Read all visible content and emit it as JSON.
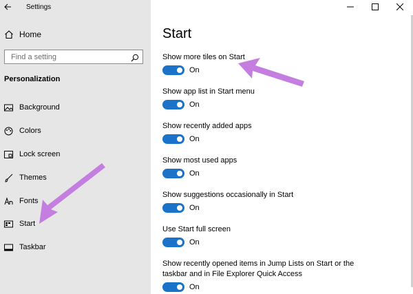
{
  "window": {
    "title": "Settings"
  },
  "sidebar": {
    "home_label": "Home",
    "search_placeholder": "Find a setting",
    "section_title": "Personalization",
    "items": [
      {
        "label": "Background",
        "icon": "picture-icon"
      },
      {
        "label": "Colors",
        "icon": "palette-icon"
      },
      {
        "label": "Lock screen",
        "icon": "lock-screen-icon"
      },
      {
        "label": "Themes",
        "icon": "brush-icon"
      },
      {
        "label": "Fonts",
        "icon": "fonts-icon"
      },
      {
        "label": "Start",
        "icon": "start-menu-icon",
        "selected": true
      },
      {
        "label": "Taskbar",
        "icon": "taskbar-icon"
      }
    ]
  },
  "main": {
    "title": "Start",
    "options": [
      {
        "label": "Show more tiles on Start",
        "state": "On"
      },
      {
        "label": "Show app list in Start menu",
        "state": "On"
      },
      {
        "label": "Show recently added apps",
        "state": "On"
      },
      {
        "label": "Show most used apps",
        "state": "On"
      },
      {
        "label": "Show suggestions occasionally in Start",
        "state": "On"
      },
      {
        "label": "Use Start full screen",
        "state": "On"
      },
      {
        "label": "Show recently opened items in Jump Lists on Start or the taskbar and in File Explorer Quick Access",
        "state": "On"
      }
    ]
  },
  "colors": {
    "accent": "#1a73c9",
    "sidebar_bg": "#e6e6e6",
    "annotation_arrow": "#c47ee0"
  }
}
